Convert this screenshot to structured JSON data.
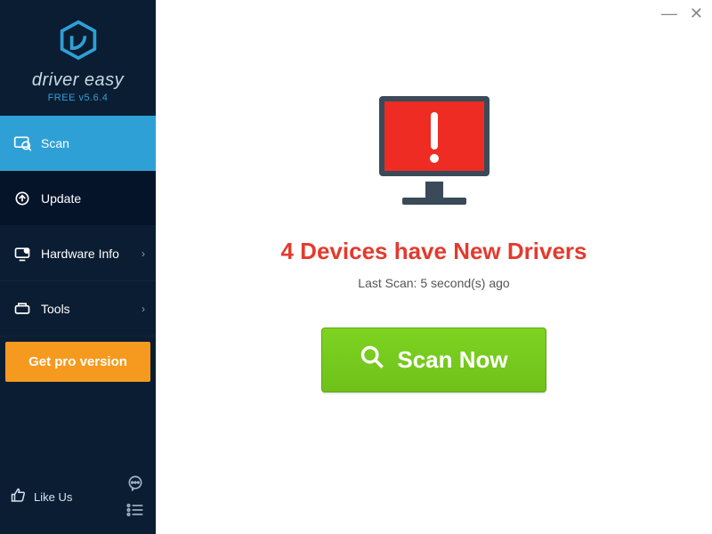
{
  "brand": {
    "name": "driver easy",
    "version": "FREE v5.6.4"
  },
  "sidebar": {
    "items": [
      {
        "label": "Scan"
      },
      {
        "label": "Update"
      },
      {
        "label": "Hardware Info"
      },
      {
        "label": "Tools"
      }
    ],
    "get_pro": "Get pro version",
    "like_us": "Like Us"
  },
  "main": {
    "headline": "4 Devices have New Drivers",
    "last_scan": "Last Scan: 5 second(s) ago",
    "scan_button": "Scan Now"
  },
  "win": {
    "minimize": "—",
    "close": "✕"
  }
}
